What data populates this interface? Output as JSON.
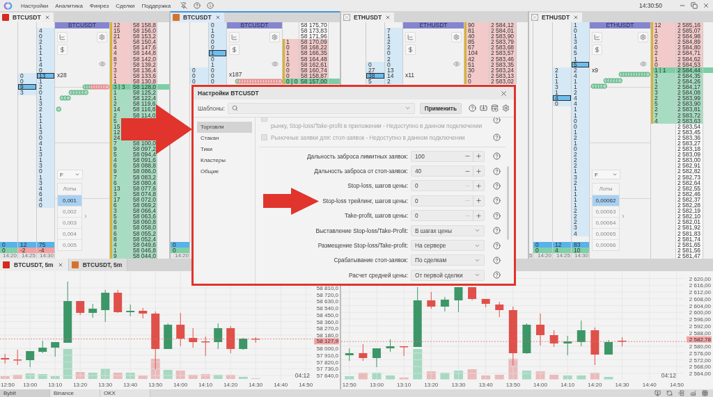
{
  "menu_bar": {
    "items": [
      "Настройки",
      "Аналитика",
      "Финрез",
      "Сделки",
      "Поддержка"
    ],
    "clock": "14:30:50"
  },
  "dom_panels": [
    {
      "tab": {
        "label": "BTCUSDT",
        "color": "#d42a20",
        "selected": false,
        "closable": true
      },
      "columns": [
        {
          "volume": "0",
          "delta": {
            "value": "0",
            "negative": false
          },
          "time": "14:20"
        },
        {
          "cells": [
            null,
            null,
            null,
            null,
            null,
            null,
            null,
            null,
            null,
            "0",
            "0",
            {
              "value": "9",
              "current": true
            },
            "3"
          ],
          "volume": "12",
          "delta": {
            "value": "-2",
            "negative": true
          },
          "time": "14:25"
        },
        {
          "cells": [
            null,
            "4",
            "0",
            "2",
            "1",
            "1",
            "1",
            "4",
            "0",
            {
              "value": "13",
              "current": true
            },
            "1",
            "2",
            "0",
            "1",
            "3",
            "2",
            "1",
            "1",
            "1",
            "3",
            "0",
            "4",
            "1",
            "3",
            "1",
            "3",
            "0",
            "1",
            "3",
            "4",
            "6",
            "4",
            "0"
          ],
          "volume": "75",
          "delta": {
            "value": "-4",
            "negative": true
          },
          "time": "14:30"
        }
      ],
      "header": "BTCUSDT",
      "multiplier": "x28",
      "lot_selector": {
        "mode": "F",
        "title": "Лоты",
        "options": [
          {
            "label": "0,001",
            "selected": true
          },
          {
            "label": "0,002",
            "selected": false
          },
          {
            "label": "0,003",
            "selected": false
          },
          {
            "label": "0,004",
            "selected": false
          },
          {
            "label": "0,005",
            "selected": false
          }
        ]
      },
      "ladder": [
        {
          "price": "58 158,8",
          "volume": "12",
          "kind": "ask"
        },
        {
          "price": "58 156,0",
          "volume": "15",
          "kind": "ask"
        },
        {
          "price": "58 153,2",
          "volume": "21",
          "kind": "ask"
        },
        {
          "price": "58 150,4",
          "volume": "5",
          "kind": "ask"
        },
        {
          "price": "58 147,6",
          "volume": "4",
          "kind": "ask"
        },
        {
          "price": "58 144,8",
          "volume": "4",
          "kind": "ask"
        },
        {
          "price": "58 142,0",
          "volume": "8",
          "kind": "ask"
        },
        {
          "price": "58 139,2",
          "volume": "7",
          "kind": "ask"
        },
        {
          "price": "58 136,4",
          "volume": "3",
          "kind": "ask"
        },
        {
          "price": "58 133,6",
          "volume": "1",
          "kind": "ask"
        },
        {
          "price": "58 130,8",
          "volume": "1",
          "kind": "ask"
        },
        {
          "price": "58 128,0",
          "volume": "3 | 3",
          "kind": "last"
        },
        {
          "price": "58 125,2",
          "volume": "1",
          "kind": "bid"
        },
        {
          "price": "58 122,4",
          "volume": "1",
          "kind": "bid"
        },
        {
          "price": "58 119,6",
          "volume": "2",
          "kind": "bid"
        },
        {
          "price": "58 116,8",
          "volume": "14",
          "kind": "bid"
        },
        {
          "price": "58 114,0",
          "volume": "2",
          "kind": "bid"
        },
        {
          "volume": "5",
          "kind": "bid"
        },
        {
          "volume": "15",
          "kind": "bid"
        },
        {
          "volume": "12",
          "kind": "bid"
        },
        {
          "volume": "24",
          "kind": "bid"
        },
        {
          "price": "58 100,0",
          "volume": "7",
          "kind": "bid"
        },
        {
          "price": "58 097,2",
          "volume": "9",
          "kind": "bid"
        },
        {
          "price": "58 094,4",
          "volume": "5",
          "kind": "bid"
        },
        {
          "price": "58 091,6",
          "volume": "4",
          "kind": "bid"
        },
        {
          "price": "58 088,8",
          "volume": "6",
          "kind": "bid"
        },
        {
          "price": "58 086,0",
          "volume": "9",
          "kind": "bid"
        },
        {
          "price": "58 083,2",
          "volume": "7",
          "kind": "bid"
        },
        {
          "price": "58 080,4",
          "volume": "6",
          "kind": "bid"
        },
        {
          "price": "58 077,6",
          "volume": "13",
          "kind": "bid"
        },
        {
          "price": "58 074,8",
          "volume": "3",
          "kind": "bid"
        },
        {
          "price": "58 072,0",
          "volume": "17",
          "kind": "bid"
        },
        {
          "price": "58 069,2",
          "volume": "6",
          "kind": "bid"
        },
        {
          "price": "58 066,4",
          "volume": "3",
          "kind": "bid"
        },
        {
          "price": "58 063,6",
          "volume": "5",
          "kind": "bid"
        },
        {
          "price": "58 060,8",
          "volume": "6",
          "kind": "bid"
        },
        {
          "price": "58 058,0",
          "volume": "8",
          "kind": "bid"
        },
        {
          "price": "58 055,2",
          "volume": "6",
          "kind": "bid"
        },
        {
          "price": "58 052,4",
          "volume": "8",
          "kind": "bid"
        },
        {
          "price": "58 049,6",
          "volume": "4",
          "kind": "bid"
        },
        {
          "price": "58 046,8",
          "volume": "1",
          "kind": "bid"
        },
        {
          "price": "58 044,0",
          "volume": "9",
          "kind": "bid"
        }
      ]
    },
    {
      "tab": {
        "label": "BTCUSDT",
        "color": "#d8722a",
        "selected": true,
        "closable": true
      },
      "columns": [
        {
          "volume": "0",
          "delta": {
            "value": "0",
            "negative": false
          },
          "time": "14:20"
        },
        {
          "cells": [
            null,
            null,
            null,
            null,
            null,
            null,
            null,
            null,
            "0",
            "0",
            "0"
          ]
        },
        {
          "cells": [
            "0",
            "1",
            "0",
            "0",
            "0",
            {
              "value": "1",
              "current": true
            },
            "0",
            "1",
            "0",
            "0",
            "0"
          ]
        }
      ],
      "header": "BTCUSDT",
      "multiplier": "x187",
      "ladder": [
        {
          "price": "58 175,70",
          "kind": "neutral"
        },
        {
          "price": "58 173,83",
          "kind": "neutral"
        },
        {
          "price": "58 171,96",
          "kind": "neutral"
        },
        {
          "price": "58 170,09",
          "volume": "1",
          "kind": "ask"
        },
        {
          "price": "58 168,22",
          "volume": "0",
          "kind": "ask"
        },
        {
          "price": "58 166,35",
          "volume": "1",
          "kind": "ask"
        },
        {
          "price": "58 164,48",
          "volume": "1",
          "kind": "ask"
        },
        {
          "price": "58 162,61",
          "volume": "0",
          "kind": "ask"
        },
        {
          "price": "58 160,74",
          "volume": "0",
          "kind": "ask"
        },
        {
          "price": "58 158,87",
          "volume": "0",
          "kind": "ask"
        },
        {
          "price": "58 157,00",
          "volume": "0 | 0",
          "kind": "last"
        }
      ]
    },
    {
      "tab": {
        "label": "ETHUSDT",
        "selected": false,
        "closable": true
      },
      "columns": [
        null,
        {
          "cells": [
            null,
            null,
            null,
            null,
            null,
            null,
            null,
            "0",
            "27",
            {
              "value": "38",
              "current": true
            },
            "5"
          ]
        },
        {
          "cells": [
            null,
            "7",
            "1",
            "2",
            "2",
            "0",
            "2",
            "0",
            "13",
            "14",
            "2"
          ]
        }
      ],
      "header": "ETHUSDT",
      "multiplier": "x11",
      "ladder": [
        {
          "price": "2 584,12",
          "volume": "90",
          "kind": "ask"
        },
        {
          "price": "2 584,01",
          "volume": "81",
          "kind": "ask"
        },
        {
          "price": "2 583,90",
          "volume": "40",
          "kind": "ask"
        },
        {
          "price": "2 583,79",
          "volume": "85",
          "kind": "ask"
        },
        {
          "price": "2 583,68",
          "volume": "67",
          "kind": "ask"
        },
        {
          "price": "2 583,57",
          "volume": "104",
          "kind": "ask"
        },
        {
          "price": "2 583,46",
          "volume": "42",
          "kind": "ask"
        },
        {
          "price": "2 583,35",
          "volume": "51",
          "kind": "ask"
        },
        {
          "price": "2 583,24",
          "volume": "30",
          "kind": "ask"
        },
        {
          "price": "2 583,13",
          "volume": "0",
          "kind": "ask"
        },
        {
          "price": "2 583,02",
          "volume": "0",
          "kind": "ask"
        }
      ]
    },
    {
      "tab": {
        "label": "ETHUSDT",
        "selected": false,
        "closable": true
      },
      "columns": [
        {
          "time": "5"
        },
        {
          "volume": "0",
          "delta": {
            "value": "0",
            "negative": false
          },
          "time": "14:20"
        },
        {
          "cells": [
            null,
            null,
            null,
            null,
            null,
            null,
            null,
            null,
            "2",
            "1",
            "1",
            "3",
            "1",
            {
              "value": "4",
              "current": true
            },
            "0"
          ],
          "volume": "12",
          "delta": {
            "value": "4",
            "negative": false
          },
          "time": "14:25"
        },
        {
          "cells": [
            "1",
            "0",
            "1",
            "3",
            "4",
            "5",
            "1",
            {
              "value": "5",
              "current": true
            },
            "2",
            "4",
            "1",
            "1",
            "2",
            "4",
            "4",
            "1",
            "1",
            "0",
            "0",
            "1",
            "2",
            "1",
            "0",
            "2",
            "2",
            "2",
            "1",
            "3",
            "2",
            "1",
            "1",
            "1",
            "1",
            "2",
            "2",
            "2",
            "3",
            "4"
          ],
          "volume": "83",
          "delta": {
            "value": "10",
            "negative": false
          },
          "time": "14:30"
        }
      ],
      "header": "ETHUSDT",
      "multiplier": "x9",
      "lot_selector": {
        "mode": "F",
        "title": "Лоты",
        "options": [
          {
            "label": "0,00062",
            "selected": true
          },
          {
            "label": "0,00063",
            "selected": false
          },
          {
            "label": "0,00064",
            "selected": false
          },
          {
            "label": "0,00065",
            "selected": false
          },
          {
            "label": "0,00066",
            "selected": false
          }
        ]
      },
      "ladder": [
        {
          "price": "2 585,16",
          "volume": "12",
          "kind": "ask"
        },
        {
          "price": "2 585,07",
          "volume": "1",
          "kind": "ask"
        },
        {
          "price": "2 584,98",
          "volume": "0",
          "kind": "ask"
        },
        {
          "price": "2 584,89",
          "volume": "2",
          "kind": "ask"
        },
        {
          "price": "2 584,80",
          "volume": "0",
          "kind": "ask"
        },
        {
          "price": "2 584,71",
          "volume": "2",
          "kind": "ask"
        },
        {
          "price": "2 584,62",
          "volume": "1",
          "kind": "ask"
        },
        {
          "price": "2 584,53",
          "volume": "0",
          "kind": "ask"
        },
        {
          "price": "2 584,44",
          "volume": "1 | 1",
          "kind": "last"
        },
        {
          "price": "2 584,35",
          "volume": "3",
          "kind": "bid"
        },
        {
          "price": "2 584,26",
          "volume": "1",
          "kind": "bid"
        },
        {
          "price": "2 584,17",
          "volume": "2",
          "kind": "bid"
        },
        {
          "price": "2 584,08",
          "volume": "3",
          "kind": "bid"
        },
        {
          "price": "2 583,99",
          "volume": "2",
          "kind": "bid"
        },
        {
          "price": "2 583,90",
          "volume": "5",
          "kind": "bid"
        },
        {
          "price": "2 583,81",
          "volume": "2",
          "kind": "bid"
        },
        {
          "price": "2 583,72",
          "volume": "7",
          "kind": "bid"
        },
        {
          "price": "2 583,63",
          "volume": "4",
          "kind": "bid"
        },
        {
          "price": "2 583,54",
          "kind": "neutral"
        },
        {
          "price": "2 583,45",
          "kind": "neutral"
        },
        {
          "price": "2 583,36",
          "kind": "neutral"
        },
        {
          "price": "2 583,27",
          "kind": "neutral"
        },
        {
          "price": "2 583,18",
          "kind": "neutral"
        },
        {
          "price": "2 583,09",
          "kind": "neutral"
        },
        {
          "price": "2 583,00",
          "kind": "neutral"
        },
        {
          "price": "2 582,91",
          "kind": "neutral"
        },
        {
          "price": "2 582,82",
          "kind": "neutral"
        },
        {
          "price": "2 582,73",
          "kind": "neutral"
        },
        {
          "price": "2 582,64",
          "kind": "neutral"
        },
        {
          "price": "2 582,55",
          "kind": "neutral"
        },
        {
          "price": "2 582,46",
          "kind": "neutral"
        },
        {
          "price": "2 582,37",
          "kind": "neutral"
        },
        {
          "price": "2 582,28",
          "kind": "neutral"
        },
        {
          "price": "2 582,19",
          "kind": "neutral"
        },
        {
          "price": "2 582,10",
          "kind": "neutral"
        },
        {
          "price": "2 582,01",
          "kind": "neutral"
        },
        {
          "price": "2 581,92",
          "kind": "neutral"
        },
        {
          "price": "2 581,83",
          "kind": "neutral"
        },
        {
          "price": "2 581,74",
          "kind": "neutral"
        },
        {
          "price": "2 581,65",
          "kind": "neutral"
        },
        {
          "price": "2 581,56",
          "kind": "neutral"
        },
        {
          "price": "2 581,47",
          "kind": "neutral"
        }
      ]
    }
  ],
  "chart_panels": [
    {
      "tabs": [
        {
          "label": "BTCUSDT, 5m",
          "color": "#d42a20",
          "selected": true,
          "closable": true
        },
        {
          "label": "BTCUSDT, 5m",
          "color": "#d8722a",
          "selected": false,
          "closable": false
        }
      ],
      "chart_data": {
        "type": "candlestick",
        "grid": true,
        "x": [
          770,
          775,
          780,
          785,
          790,
          795,
          800,
          805,
          810,
          815,
          820,
          825,
          830,
          835,
          840,
          845,
          850,
          855,
          860,
          865,
          870
        ],
        "ohlc": [
          [
            57873,
            57929,
            57799,
            57854
          ],
          [
            57854,
            57984,
            57780,
            57845
          ],
          [
            57845,
            57966,
            57752,
            57966
          ],
          [
            57956,
            58105,
            57938,
            58012
          ],
          [
            58012,
            58086,
            57892,
            58086
          ],
          [
            58077,
            58894,
            58077,
            58634
          ],
          [
            58634,
            58634,
            58448,
            58476
          ],
          [
            58476,
            58597,
            58411,
            58532
          ],
          [
            58513,
            58782,
            58355,
            58745
          ],
          [
            58745,
            58782,
            58476,
            58485
          ],
          [
            58485,
            58587,
            58430,
            58504
          ],
          [
            58504,
            58541,
            58402,
            58467
          ],
          [
            58467,
            58495,
            57725,
            57994
          ],
          [
            57994,
            58337,
            57994,
            58318
          ],
          [
            58318,
            58476,
            58031,
            58133
          ],
          [
            58142,
            58272,
            58012,
            58086
          ],
          [
            58096,
            58161,
            57901,
            58086
          ],
          [
            58086,
            58337,
            57994,
            58272
          ],
          [
            58272,
            58300,
            57938,
            57994
          ],
          [
            57994,
            58142,
            57984,
            58133
          ],
          [
            58133,
            58151,
            58077,
            58128
          ]
        ],
        "xlim": [
          770,
          890
        ],
        "ylim": [
          57640,
          59033
        ],
        "xticks": [
          {
            "value": 770,
            "label": "12:50"
          },
          {
            "value": 780,
            "label": "13:00"
          },
          {
            "value": 790,
            "label": "13:10"
          },
          {
            "value": 800,
            "label": "13:20"
          },
          {
            "value": 810,
            "label": "13:30"
          },
          {
            "value": 820,
            "label": "13:40"
          },
          {
            "value": 830,
            "label": "13:50"
          },
          {
            "value": 840,
            "label": "14:00"
          },
          {
            "value": 850,
            "label": "14:10"
          },
          {
            "value": 860,
            "label": "14:20"
          },
          {
            "value": 870,
            "label": "14:30"
          },
          {
            "value": 880,
            "label": "14:40"
          },
          {
            "value": 890,
            "label": "14:50"
          }
        ],
        "yticks": [
          {
            "value": 58810,
            "label": "58 810,0"
          },
          {
            "value": 58720,
            "label": "58 720,0"
          },
          {
            "value": 58630,
            "label": "58 630,0"
          },
          {
            "value": 58540,
            "label": "58 540,0"
          },
          {
            "value": 58450,
            "label": "58 450,0"
          },
          {
            "value": 58360,
            "label": "58 360,0"
          },
          {
            "value": 58270,
            "label": "58 270,0"
          },
          {
            "value": 58180,
            "label": "58 180,0"
          },
          {
            "value": 58000,
            "label": "58 000,0"
          },
          {
            "value": 57910,
            "label": "57 910,0"
          },
          {
            "value": 57820,
            "label": "57 820,0"
          },
          {
            "value": 57730,
            "label": "57 730,0"
          },
          {
            "value": 57640,
            "label": "57 640,0"
          }
        ],
        "ref_lines": [
          {
            "axis": "y",
            "value": 58127.9,
            "label": "58 127,9"
          }
        ]
      },
      "timer": "04:12"
    },
    {
      "chart_data": {
        "type": "candlestick",
        "grid": true,
        "x": [
          770,
          775,
          780,
          785,
          790,
          795,
          800,
          805,
          810,
          815,
          820,
          825,
          830,
          835,
          840,
          845,
          850,
          855,
          860,
          865,
          870
        ],
        "ohlc": [
          [
            2574.67,
            2578.77,
            2571.38,
            2575.9
          ],
          [
            2575.9,
            2581.23,
            2571.38,
            2573.03
          ],
          [
            2573.03,
            2578.77,
            2567.69,
            2578.77
          ],
          [
            2578.77,
            2584.1,
            2576.72,
            2580.0
          ],
          [
            2580.0,
            2580.0,
            2574.26,
            2579.59
          ],
          [
            2579.59,
            2614.87,
            2579.59,
            2607.08
          ],
          [
            2607.08,
            2612.0,
            2602.15,
            2603.38
          ],
          [
            2603.38,
            2609.13,
            2600.51,
            2607.49
          ],
          [
            2607.08,
            2614.87,
            2600.1,
            2614.87
          ],
          [
            2614.87,
            2614.87,
            2607.08,
            2607.9
          ],
          [
            2607.9,
            2607.9,
            2602.97,
            2605.03
          ],
          [
            2604.62,
            2606.26,
            2597.23,
            2601.33
          ],
          [
            2601.33,
            2603.38,
            2568.51,
            2575.9
          ],
          [
            2575.9,
            2593.54,
            2575.49,
            2592.72
          ],
          [
            2592.72,
            2599.28,
            2580.41,
            2586.56
          ],
          [
            2586.56,
            2589.44,
            2579.59,
            2581.64
          ],
          [
            2581.64,
            2586.15,
            2574.67,
            2582.87
          ],
          [
            2582.46,
            2595.18,
            2580.0,
            2589.44
          ],
          [
            2589.44,
            2591.08,
            2568.92,
            2575.08
          ],
          [
            2575.08,
            2583.69,
            2575.08,
            2582.46
          ],
          [
            2583.28,
            2585.33,
            2580.0,
            2582.78
          ]
        ],
        "xlim": [
          770,
          890
        ],
        "ylim": [
          2564,
          2620
        ],
        "xticks": [
          {
            "value": 770,
            "label": "12:50"
          },
          {
            "value": 780,
            "label": "13:00"
          },
          {
            "value": 790,
            "label": "13:10"
          },
          {
            "value": 800,
            "label": "13:20"
          },
          {
            "value": 810,
            "label": "13:30"
          },
          {
            "value": 820,
            "label": "13:40"
          },
          {
            "value": 830,
            "label": "13:50"
          },
          {
            "value": 840,
            "label": "14:00"
          },
          {
            "value": 850,
            "label": "14:10"
          },
          {
            "value": 860,
            "label": "14:20"
          },
          {
            "value": 870,
            "label": "14:30"
          },
          {
            "value": 880,
            "label": "14:40"
          },
          {
            "value": 890,
            "label": "14:50"
          }
        ],
        "yticks": [
          {
            "value": 2620,
            "label": "2 620,00"
          },
          {
            "value": 2616,
            "label": "2 616,00"
          },
          {
            "value": 2612,
            "label": "2 612,00"
          },
          {
            "value": 2608,
            "label": "2 608,00"
          },
          {
            "value": 2604,
            "label": "2 604,00"
          },
          {
            "value": 2600,
            "label": "2 600,00"
          },
          {
            "value": 2596,
            "label": "2 596,00"
          },
          {
            "value": 2592,
            "label": "2 592,00"
          },
          {
            "value": 2588,
            "label": "2 588,00"
          },
          {
            "value": 2580,
            "label": "2 580,00"
          },
          {
            "value": 2576,
            "label": "2 576,00"
          },
          {
            "value": 2572,
            "label": "2 572,00"
          },
          {
            "value": 2568,
            "label": "2 568,00"
          },
          {
            "value": 2564,
            "label": "2 564,00"
          }
        ],
        "ref_lines": [
          {
            "axis": "y",
            "value": 2582.78,
            "label": "2 582,78"
          }
        ]
      },
      "timer": "04:12"
    }
  ],
  "exchange_tabs": [
    {
      "label": "Bybit",
      "selected": true
    },
    {
      "label": "Binance",
      "selected": false
    },
    {
      "label": "OKX",
      "selected": false
    }
  ],
  "settings_dialog": {
    "title": "Настройки BTCUSDT",
    "templates_label": "Шаблоны:",
    "apply_button": "Применить",
    "sections": [
      {
        "label": "Торговля",
        "selected": true
      },
      {
        "label": "Стакан",
        "selected": false
      },
      {
        "label": "Тики",
        "selected": false
      },
      {
        "label": "Кластеры",
        "selected": false
      },
      {
        "label": "Общие",
        "selected": false
      }
    ],
    "options": [
      {
        "text": "рынку, Stop-loss/Take-profit в приложении - Недоступно в данном подключении",
        "checked": false,
        "disabled": true
      },
      {
        "text": "Рыночные заявки для: стоп-заявок - Недоступно в данном подключении",
        "checked": false,
        "disabled": true
      }
    ],
    "fields": [
      {
        "kind": "stepper",
        "label": "Дальность заброса лимитных заявок:",
        "value": "100",
        "decrement_enabled": true
      },
      {
        "kind": "stepper",
        "label": "Дальность заброса от стоп-заявок:",
        "value": "40",
        "decrement_enabled": true
      },
      {
        "kind": "stepper",
        "label": "Stop-loss, шагов цены:",
        "value": "0",
        "decrement_enabled": false
      },
      {
        "kind": "stepper",
        "label": "Stop-loss трейлинг, шагов цены:",
        "value": "0",
        "decrement_enabled": false
      },
      {
        "kind": "stepper",
        "label": "Take-profit, шагов цены:",
        "value": "0",
        "decrement_enabled": false
      },
      {
        "kind": "select",
        "label": "Выставление Stop-loss/Take-Profit:",
        "value": "В шагах цены"
      },
      {
        "kind": "select",
        "label": "Размещение Stop-loss/Take-profit:",
        "value": "На сервере"
      },
      {
        "kind": "select",
        "label": "Срабатывание стоп-заявок:",
        "value": "По сделкам"
      },
      {
        "kind": "select",
        "label": "Расчет средней цены:",
        "value": "От первой сделки"
      }
    ]
  }
}
